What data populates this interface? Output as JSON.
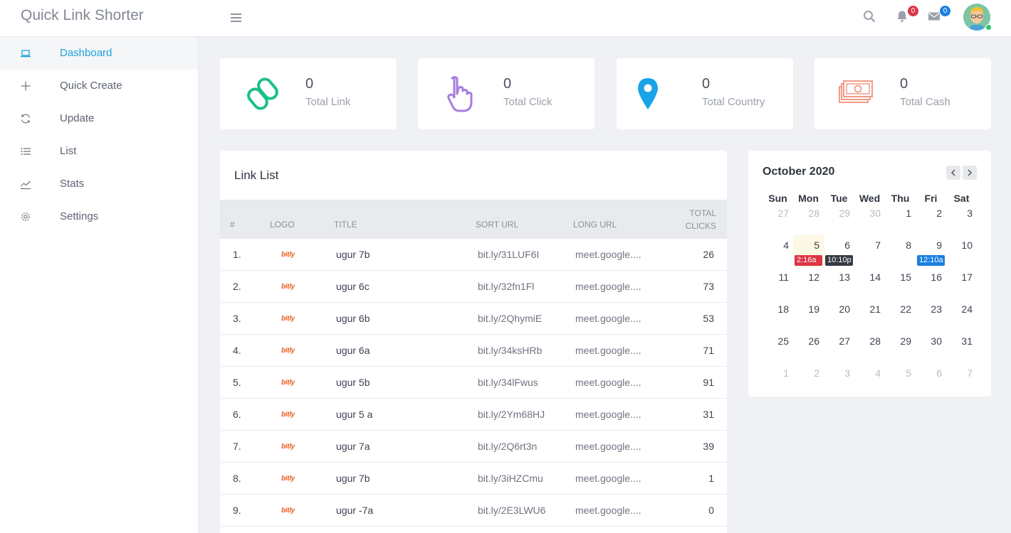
{
  "header": {
    "brand": "Quick Link Shorter",
    "notifications_count": "0",
    "messages_count": "0"
  },
  "sidebar": {
    "items": [
      {
        "label": "Dashboard",
        "icon": "laptop-icon",
        "active": true
      },
      {
        "label": "Quick Create",
        "icon": "plus-icon"
      },
      {
        "label": "Update",
        "icon": "refresh-icon"
      },
      {
        "label": "List",
        "icon": "list-icon"
      },
      {
        "label": "Stats",
        "icon": "chart-line-icon"
      },
      {
        "label": "Settings",
        "icon": "gear-icon"
      }
    ]
  },
  "stats": [
    {
      "value": "0",
      "label": "Total Link",
      "icon": "link-icon",
      "color": "#1bbf8c"
    },
    {
      "value": "0",
      "label": "Total Click",
      "icon": "pointer-hand-icon",
      "color": "#a67ee0"
    },
    {
      "value": "0",
      "label": "Total Country",
      "icon": "map-pin-icon",
      "color": "#1aa3e8"
    },
    {
      "value": "0",
      "label": "Total Cash",
      "icon": "money-icon",
      "color": "#f29b85"
    }
  ],
  "link_list": {
    "title": "Link List",
    "columns": {
      "num": "#",
      "logo": "LOGO",
      "title": "TITLE",
      "short_url": "SORT URL",
      "long_url": "LONG URL",
      "clicks_line1": "TOTAL",
      "clicks_line2": "CLICKS"
    },
    "rows": [
      {
        "num": "1.",
        "logo": "bitly",
        "title": "ugur 7b",
        "short_url": "bit.ly/31LUF6I",
        "long_url": "meet.google....",
        "clicks": "26"
      },
      {
        "num": "2.",
        "logo": "bitly",
        "title": "ugur 6c",
        "short_url": "bit.ly/32fn1Fl",
        "long_url": "meet.google....",
        "clicks": "73"
      },
      {
        "num": "3.",
        "logo": "bitly",
        "title": "ugur 6b",
        "short_url": "bit.ly/2QhymiE",
        "long_url": "meet.google....",
        "clicks": "53"
      },
      {
        "num": "4.",
        "logo": "bitly",
        "title": "ugur 6a",
        "short_url": "bit.ly/34ksHRb",
        "long_url": "meet.google....",
        "clicks": "71"
      },
      {
        "num": "5.",
        "logo": "bitly",
        "title": "ugur 5b",
        "short_url": "bit.ly/34lFwus",
        "long_url": "meet.google....",
        "clicks": "91"
      },
      {
        "num": "6.",
        "logo": "bitly",
        "title": "ugur 5 a",
        "short_url": "bit.ly/2Ym68HJ",
        "long_url": "meet.google....",
        "clicks": "31"
      },
      {
        "num": "7.",
        "logo": "bitly",
        "title": "ugur 7a",
        "short_url": "bit.ly/2Q6rt3n",
        "long_url": "meet.google....",
        "clicks": "39"
      },
      {
        "num": "8.",
        "logo": "bitly",
        "title": "ugur 7b",
        "short_url": "bit.ly/3iHZCmu",
        "long_url": "meet.google....",
        "clicks": "1"
      },
      {
        "num": "9.",
        "logo": "bitly",
        "title": "ugur -7a",
        "short_url": "bit.ly/2E3LWU6",
        "long_url": "meet.google....",
        "clicks": "0"
      }
    ]
  },
  "calendar": {
    "title": "October 2020",
    "weekdays": [
      "Sun",
      "Mon",
      "Tue",
      "Wed",
      "Thu",
      "Fri",
      "Sat"
    ],
    "weeks": [
      [
        "27",
        "28",
        "29",
        "30",
        "1",
        "2",
        "3"
      ],
      [
        "4",
        "5",
        "6",
        "7",
        "8",
        "9",
        "10"
      ],
      [
        "11",
        "12",
        "13",
        "14",
        "15",
        "16",
        "17"
      ],
      [
        "18",
        "19",
        "20",
        "21",
        "22",
        "23",
        "24"
      ],
      [
        "25",
        "26",
        "27",
        "28",
        "29",
        "30",
        "31"
      ],
      [
        "1",
        "2",
        "3",
        "4",
        "5",
        "6",
        "7"
      ]
    ],
    "events": [
      {
        "label": "2:16a",
        "day": "5",
        "color": "#dc3545"
      },
      {
        "label": "10:10p",
        "day": "6",
        "color": "#343a40"
      },
      {
        "label": "12:10a",
        "day": "9",
        "color": "#1a7fe0"
      }
    ],
    "colors": {
      "today": "#fcf8e3"
    }
  }
}
